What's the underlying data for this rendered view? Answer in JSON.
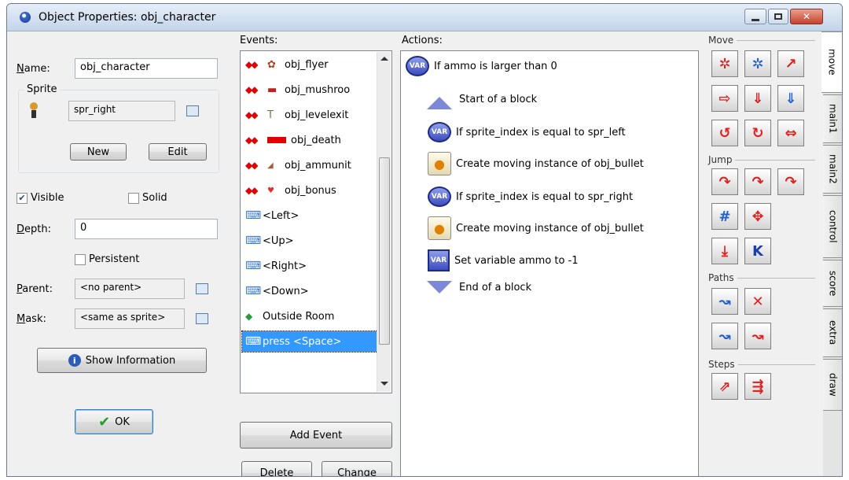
{
  "window": {
    "title": "Object Properties: obj_character"
  },
  "left_panel": {
    "name_label": "Name:",
    "name_value": "obj_character",
    "sprite_group_label": "Sprite",
    "sprite_value": "spr_right",
    "new_label": "New",
    "edit_label": "Edit",
    "visible_label": "Visible",
    "visible_checked": true,
    "solid_label": "Solid",
    "solid_checked": false,
    "depth_label": "Depth:",
    "depth_value": "0",
    "persistent_label": "Persistent",
    "persistent_checked": false,
    "parent_label": "Parent:",
    "parent_value": "<no parent>",
    "mask_label": "Mask:",
    "mask_value": "<same as sprite>",
    "show_info_label": "Show Information",
    "ok_label": "OK"
  },
  "events": {
    "header": "Events:",
    "items": [
      {
        "label": "obj_flyer",
        "icon": "collision-icon"
      },
      {
        "label": "obj_mushroo",
        "icon": "collision-icon"
      },
      {
        "label": "obj_levelexit",
        "icon": "collision-icon"
      },
      {
        "label": "obj_death",
        "icon": "collision-icon"
      },
      {
        "label": "obj_ammunit",
        "icon": "collision-icon"
      },
      {
        "label": "obj_bonus",
        "icon": "collision-icon"
      },
      {
        "label": "<Left>",
        "icon": "keyboard-icon"
      },
      {
        "label": "<Up>",
        "icon": "keyboard-icon"
      },
      {
        "label": "<Right>",
        "icon": "keyboard-icon"
      },
      {
        "label": "<Down>",
        "icon": "keyboard-icon"
      },
      {
        "label": "Outside Room",
        "icon": "other-event-icon"
      },
      {
        "label": "press <Space>",
        "icon": "key-press-icon",
        "selected": true
      }
    ],
    "add_event_label": "Add Event",
    "delete_label": "Delete",
    "change_label": "Change"
  },
  "actions": {
    "header": "Actions:",
    "items": [
      "If ammo is larger than 0",
      "Start of a block",
      "If sprite_index is equal to spr_left",
      "Create moving instance of obj_bullet",
      "If sprite_index is equal to spr_right",
      "Create moving instance of obj_bullet",
      "Set variable ammo to -1",
      "End of a block"
    ],
    "var_badge": "VAR"
  },
  "palette": {
    "sections": {
      "move": "Move",
      "jump": "Jump",
      "paths": "Paths",
      "steps": "Steps"
    },
    "tabs": [
      "move",
      "main1",
      "main2",
      "control",
      "score",
      "extra",
      "draw"
    ]
  },
  "colors": {
    "selection": "#3399ff",
    "collision_arrows": "#e00000",
    "tool_red": "#e02020",
    "tool_blue": "#2060d0"
  }
}
